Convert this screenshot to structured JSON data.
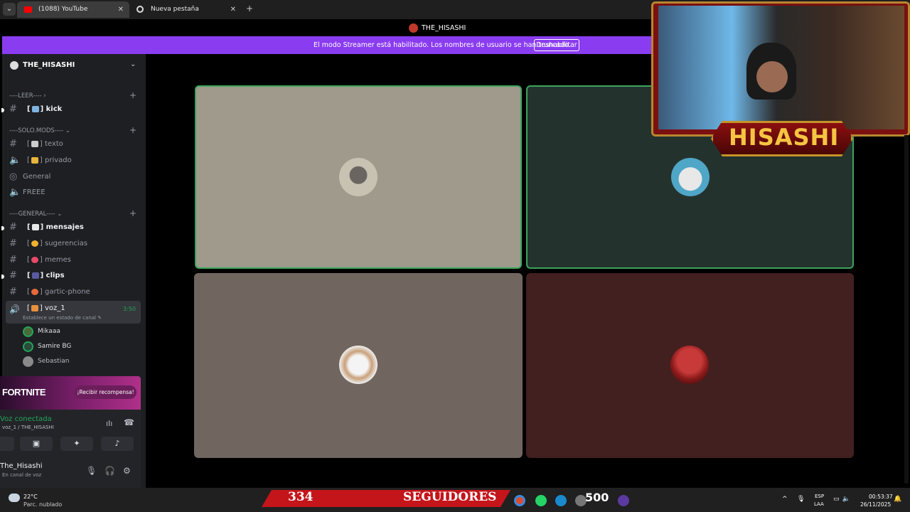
{
  "browser": {
    "tabs": [
      {
        "label": "(1088) YouTube",
        "close": "✕"
      },
      {
        "label": "Nueva pestaña",
        "close": "✕"
      }
    ],
    "menu": "⌄",
    "new_tab": "+"
  },
  "header": {
    "server": "THE_HISASHI"
  },
  "banner": {
    "text": "El modo Streamer está habilitado. Los nombres de usuario se han truncado.",
    "button": "Deshabilitar",
    "color": "#8a3cf0"
  },
  "sidebar": {
    "guild_name": "THE_HISASHI",
    "categories": [
      "----LEER---- ›",
      "----SOLO.MODS---- ⌄",
      "----GENERAL---- ⌄"
    ],
    "plus": "+",
    "channels": [
      {
        "name": "kick",
        "icon": "hash",
        "unread": true
      },
      {
        "name": "texto",
        "icon": "hash-voice",
        "unread": false
      },
      {
        "name": "privado",
        "icon": "speaker",
        "unread": false
      },
      {
        "name": "General",
        "icon": "stage",
        "unread": false
      },
      {
        "name": "FREEE",
        "icon": "speaker",
        "unread": false
      },
      {
        "name": "mensajes",
        "icon": "hash",
        "unread": true
      },
      {
        "name": "sugerencias",
        "icon": "hash",
        "unread": false
      },
      {
        "name": "memes",
        "icon": "hash",
        "unread": false
      },
      {
        "name": "clips",
        "icon": "hash",
        "unread": true
      },
      {
        "name": "gartic-phone",
        "icon": "hash",
        "unread": false
      }
    ],
    "bracket_open": "[",
    "bracket_close": "]",
    "voice": {
      "name": "voz_1",
      "timer": "3:50",
      "status": "Establece un estado de canal ✎",
      "members": [
        "Mikaaa",
        "Samire BG",
        "Sebastian"
      ]
    }
  },
  "promo": {
    "logo": "FORTNITE",
    "button": "¡Recibir recompensa!"
  },
  "voice_panel": {
    "connected": "Voz conectada",
    "channel_line": "voz_1 / THE_HISASHI",
    "user": "The_Hisashi",
    "user_status": "En canal de voz",
    "accent": "#23a55a"
  },
  "webcam": {
    "name": "HISASHI"
  },
  "taskbar": {
    "temp": "22°C",
    "weather": "Parc. nublado",
    "followers": "334",
    "followers_label": "SEGUIDORES",
    "goal": "500",
    "lang_1": "ESP",
    "lang_2": "LAA",
    "time": "00:53:37",
    "date": "26/11/2025"
  }
}
